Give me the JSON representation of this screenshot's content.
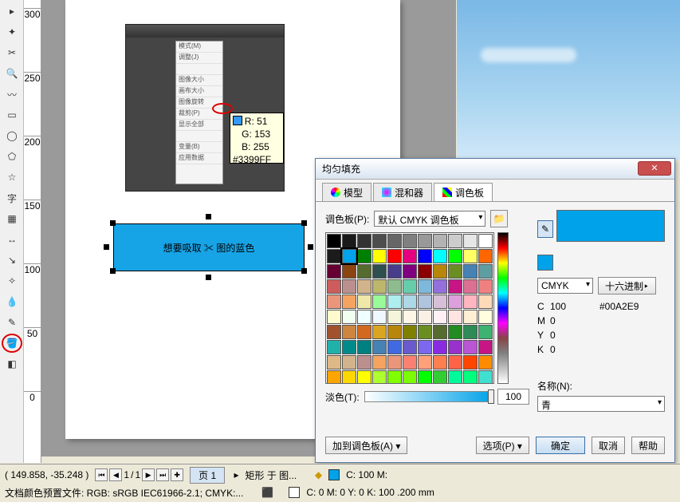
{
  "dialog": {
    "title": "均匀填充",
    "tabs": {
      "model": "模型",
      "mixer": "混和器",
      "palette": "调色板"
    },
    "palette_label": "调色板(P):",
    "palette_combo": "默认 CMYK 调色板",
    "mode": "CMYK",
    "hex_btn": "十六进制‣",
    "cmyk": {
      "c_label": "C",
      "c": "100",
      "m_label": "M",
      "m": "0",
      "y_label": "Y",
      "y": "0",
      "k_label": "K",
      "k": "0"
    },
    "hex": "#00A2E9",
    "tint_label": "淡色(T):",
    "tint_value": "100",
    "name_label": "名称(N):",
    "name_value": "青",
    "add_btn": "加到调色板(A) ▾",
    "options_btn": "选项(P) ▾",
    "ok": "确定",
    "cancel": "取消",
    "help": "帮助"
  },
  "canvas": {
    "rect_text": "想要吸取 ✂ 图的蓝色"
  },
  "ps_tooltip": {
    "r": "R: 51",
    "g": "G: 153",
    "b": "B: 255",
    "hex": "#3399FF"
  },
  "ruler_ticks": [
    "300",
    "250",
    "200",
    "150",
    "100",
    "50",
    "0"
  ],
  "status": {
    "coords": "( 149.858, -35.248 )",
    "page_current": "1",
    "page_sep": "/",
    "page_total": "1",
    "page_tab": "页 1",
    "object": "矩形 于 图...",
    "fill_info": "C: 100 M:",
    "profile": "文档颜色预置文件: RGB: sRGB IEC61966-2.1; CMYK:...",
    "outline_info": "C: 0 M: 0 Y: 0 K: 100  .200 mm"
  },
  "swatches": [
    "#000000",
    "#1a1a1a",
    "#333333",
    "#4d4d4d",
    "#666666",
    "#808080",
    "#999999",
    "#b3b3b3",
    "#cccccc",
    "#e6e6e6",
    "#ffffff",
    "#1b1b1b",
    "#00a2e9",
    "#008000",
    "#ffff00",
    "#ff0000",
    "#e4007f",
    "#0000ff",
    "#00ffff",
    "#00ff00",
    "#ffff66",
    "#ff6600",
    "#660033",
    "#8b4513",
    "#556b2f",
    "#2f4f4f",
    "#483d8b",
    "#800080",
    "#8b0000",
    "#b8860b",
    "#6b8e23",
    "#4682b4",
    "#5f9ea0",
    "#cd5c5c",
    "#bc8f8f",
    "#d2b48c",
    "#bdb76b",
    "#8fbc8f",
    "#66cdaa",
    "#7eb8da",
    "#9370db",
    "#c71585",
    "#db7093",
    "#f08080",
    "#e9967a",
    "#f4a460",
    "#eee8aa",
    "#98fb98",
    "#afeeee",
    "#add8e6",
    "#b0c4de",
    "#d8bfd8",
    "#dda0dd",
    "#ffb6c1",
    "#ffdab9",
    "#fffacd",
    "#f0fff0",
    "#f0ffff",
    "#f0f8ff",
    "#f5f5dc",
    "#fdf5e6",
    "#faf0e6",
    "#fff0f5",
    "#ffe4e1",
    "#ffefd5",
    "#ffffe0",
    "#a0522d",
    "#cd853f",
    "#d2691e",
    "#daa520",
    "#b8860b",
    "#808000",
    "#6b8e23",
    "#556b2f",
    "#228b22",
    "#2e8b57",
    "#3cb371",
    "#20b2aa",
    "#008b8b",
    "#008080",
    "#4682b4",
    "#4169e1",
    "#6a5acd",
    "#7b68ee",
    "#8a2be2",
    "#9932cc",
    "#ba55d3",
    "#c71585",
    "#deb887",
    "#d2b48c",
    "#bc8f8f",
    "#f4a460",
    "#e9967a",
    "#fa8072",
    "#ffa07a",
    "#ff7f50",
    "#ff6347",
    "#ff4500",
    "#ff8c00",
    "#ffa500",
    "#ffd700",
    "#ffff00",
    "#adff2f",
    "#7fff00",
    "#7cfc00",
    "#00ff00",
    "#32cd32",
    "#00fa9a",
    "#00ff7f",
    "#40e0d0"
  ]
}
